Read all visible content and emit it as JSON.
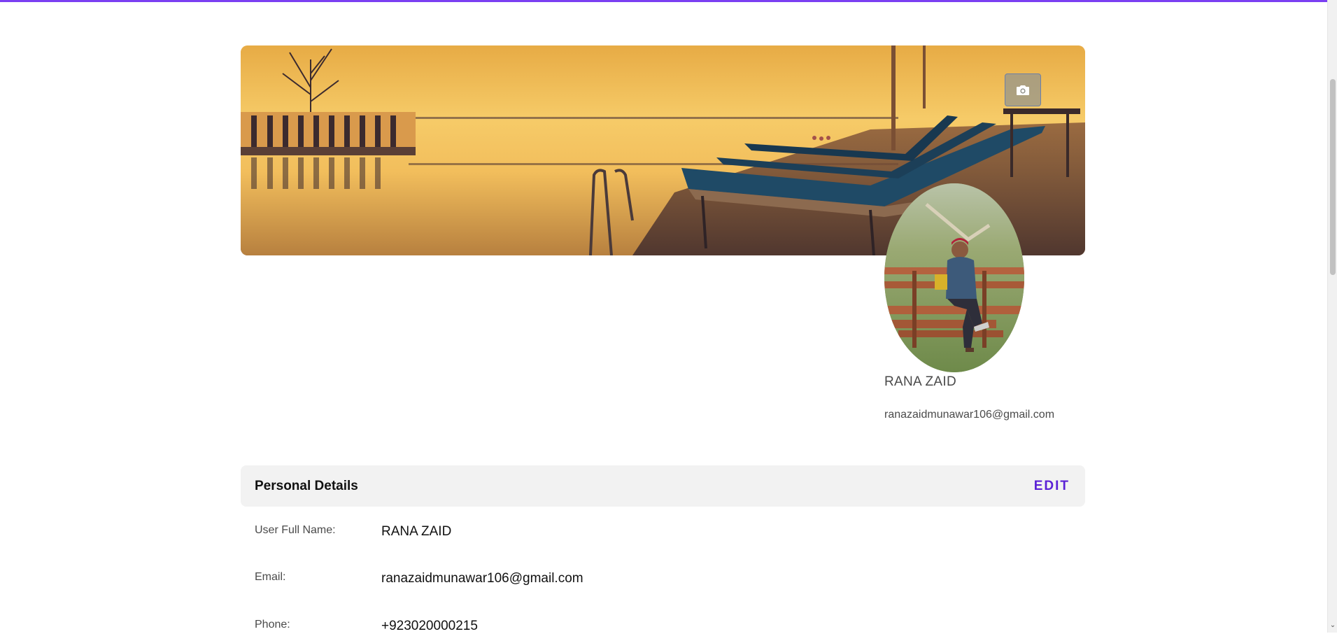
{
  "profile": {
    "name": "RANA ZAID",
    "email": "ranazaidmunawar106@gmail.com",
    "camera_icon": "camera-icon"
  },
  "details": {
    "title": "Personal Details",
    "edit_label": "EDIT",
    "rows": [
      {
        "label": "User Full Name:",
        "value": "RANA ZAID"
      },
      {
        "label": "Email:",
        "value": "ranazaidmunawar106@gmail.com"
      },
      {
        "label": "Phone:",
        "value": "+923020000215"
      }
    ]
  },
  "colors": {
    "accent": "#7b3ff2",
    "edit": "#5b21d6",
    "header_bg": "#f2f2f2"
  }
}
